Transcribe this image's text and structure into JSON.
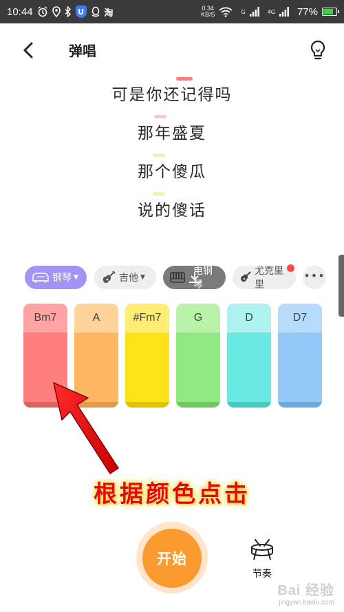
{
  "status_bar": {
    "time": "10:44",
    "net_speed_value": "0.34",
    "net_speed_unit": "KB/S",
    "signal_a": "G",
    "signal_b": "4G",
    "battery": "77%",
    "shield_label": "U",
    "app_label": "淘"
  },
  "header": {
    "title": "弹唱"
  },
  "lyrics": [
    "可是你还记得吗",
    "那年盛夏",
    "那个傻瓜",
    "说的傻话"
  ],
  "instruments": [
    {
      "label": "钢琴",
      "selected": true
    },
    {
      "label": "吉他",
      "selected": false
    },
    {
      "label": "电钢琴",
      "selected": false
    },
    {
      "label": "尤克里里",
      "selected": false
    }
  ],
  "chords": [
    {
      "name": "Bm7",
      "top": "#ffa3a3",
      "body": "#ff7e7e",
      "shadow": "#e36060"
    },
    {
      "name": "A",
      "top": "#ffd49a",
      "body": "#ffb763",
      "shadow": "#e39a45"
    },
    {
      "name": "#Fm7",
      "top": "#ffee75",
      "body": "#ffe319",
      "shadow": "#e1c400"
    },
    {
      "name": "G",
      "top": "#b9f3a9",
      "body": "#91e983",
      "shadow": "#6fcb60"
    },
    {
      "name": "D",
      "top": "#aef2f0",
      "body": "#6ae8e2",
      "shadow": "#45c9c3"
    },
    {
      "name": "D7",
      "top": "#b7dcfb",
      "body": "#92c9f7",
      "shadow": "#6ba9de"
    }
  ],
  "annotation": "根据颜色点击",
  "bottom": {
    "start_label": "开始",
    "rhythm_label": "节奏"
  },
  "watermark": {
    "brand": "Bai 经验",
    "url": "jingyan.baidu.com"
  },
  "colors": {
    "accent": "#fb9a2e",
    "piano_tab": "#a393f5"
  }
}
